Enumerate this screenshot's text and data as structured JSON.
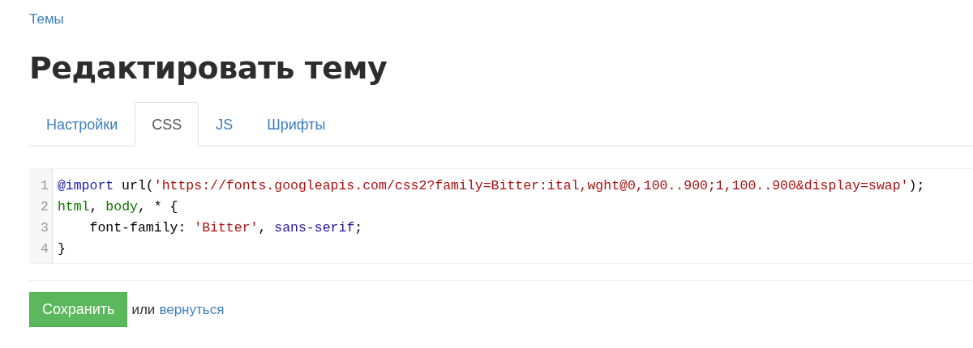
{
  "breadcrumb": "Темы",
  "title": "Редактировать тему",
  "tabs": [
    {
      "label": "Настройки",
      "selected": false
    },
    {
      "label": "CSS",
      "selected": true
    },
    {
      "label": "JS",
      "selected": false
    },
    {
      "label": "Шрифты",
      "selected": false
    }
  ],
  "editor": {
    "lines": [
      {
        "number": "1",
        "tokens": [
          {
            "text": "@import",
            "kind": "keyword"
          },
          {
            "text": " url(",
            "kind": "plain"
          },
          {
            "text": "'https://fonts.googleapis.com/css2?family=Bitter:ital,wght@0,100..900;1,100..900&display=swap'",
            "kind": "string"
          },
          {
            "text": ");",
            "kind": "plain"
          }
        ]
      },
      {
        "number": "2",
        "tokens": [
          {
            "text": "html",
            "kind": "tag"
          },
          {
            "text": ", ",
            "kind": "plain"
          },
          {
            "text": "body",
            "kind": "tag"
          },
          {
            "text": ", * {",
            "kind": "plain"
          }
        ]
      },
      {
        "number": "3",
        "tokens": [
          {
            "text": "    font-family: ",
            "kind": "plain"
          },
          {
            "text": "'Bitter'",
            "kind": "string"
          },
          {
            "text": ", ",
            "kind": "plain"
          },
          {
            "text": "sans-serif",
            "kind": "atom"
          },
          {
            "text": ";",
            "kind": "plain"
          }
        ]
      },
      {
        "number": "4",
        "tokens": [
          {
            "text": "}",
            "kind": "plain"
          }
        ]
      }
    ]
  },
  "actions": {
    "save": "Сохранить",
    "separator": "или",
    "back": "вернуться"
  }
}
